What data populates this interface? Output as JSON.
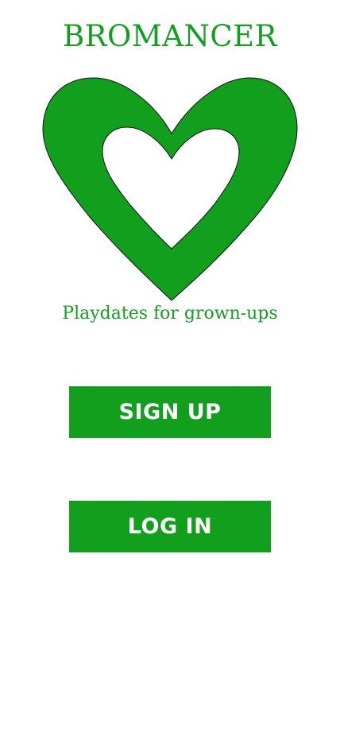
{
  "app": {
    "title": "BROMANCER",
    "tagline": "Playdates for grown-ups",
    "logo_icon": "heart-outline-icon"
  },
  "actions": {
    "signup_label": "SIGN UP",
    "login_label": "LOG IN"
  },
  "colors": {
    "brand_green": "#129f1e",
    "background": "#ffffff",
    "button_text": "#ffffff"
  }
}
